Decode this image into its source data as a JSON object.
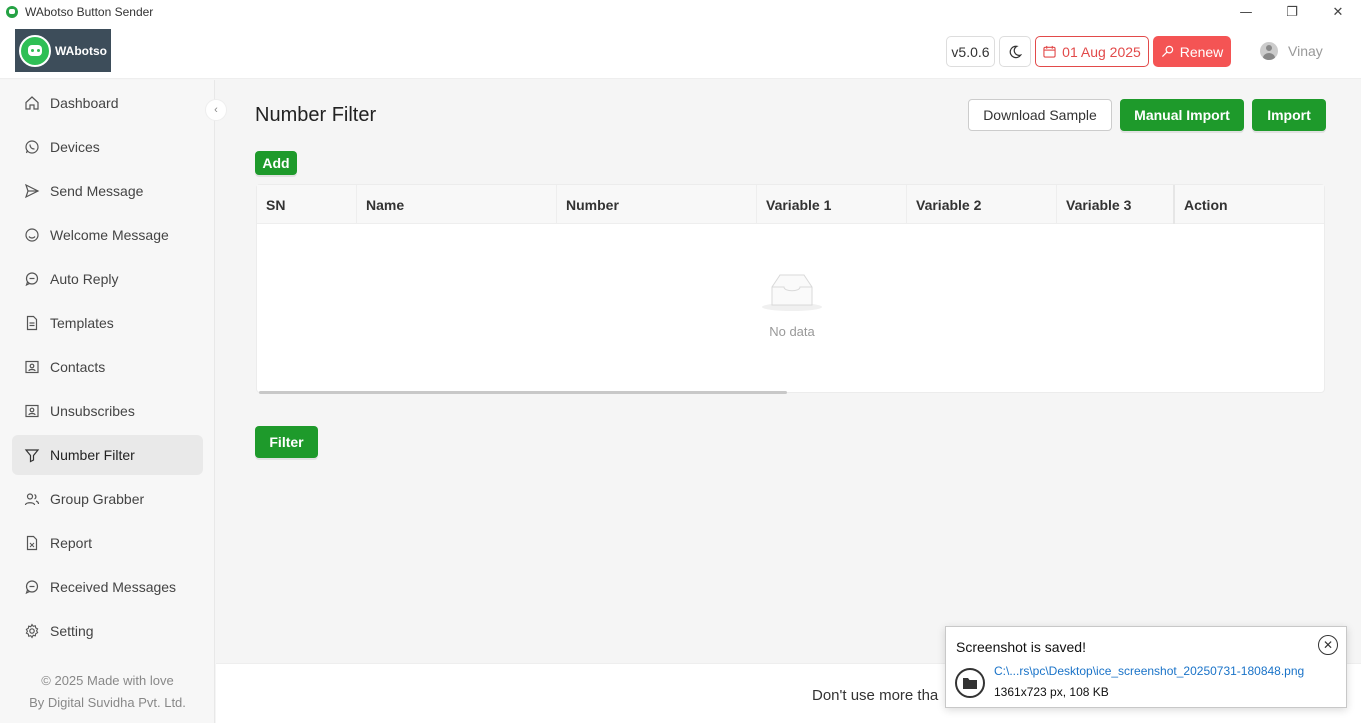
{
  "window": {
    "title": "WAbotso Button Sender",
    "controls": [
      "—",
      "❐",
      "✕"
    ]
  },
  "header": {
    "logo_text": "WAbotso",
    "version": "v5.0.6",
    "date": "01 Aug 2025",
    "renew_label": "Renew",
    "user_name": "Vinay",
    "accent_red": "#e24a4a"
  },
  "sidebar": {
    "items": [
      {
        "label": "Dashboard",
        "icon": "home-icon"
      },
      {
        "label": "Devices",
        "icon": "whatsapp-icon"
      },
      {
        "label": "Send Message",
        "icon": "send-icon"
      },
      {
        "label": "Welcome Message",
        "icon": "smile-icon"
      },
      {
        "label": "Auto Reply",
        "icon": "chat-icon"
      },
      {
        "label": "Templates",
        "icon": "document-icon"
      },
      {
        "label": "Contacts",
        "icon": "contacts-icon"
      },
      {
        "label": "Unsubscribes",
        "icon": "contacts-icon"
      },
      {
        "label": "Number Filter",
        "icon": "filter-icon"
      },
      {
        "label": "Group Grabber",
        "icon": "group-icon"
      },
      {
        "label": "Report",
        "icon": "report-icon"
      },
      {
        "label": "Received Messages",
        "icon": "chat-icon"
      },
      {
        "label": "Setting",
        "icon": "gear-icon"
      }
    ],
    "active": "Number Filter",
    "footer_line1": "© 2025 Made with love",
    "footer_line2": "By Digital Suvidha Pvt. Ltd."
  },
  "main": {
    "title": "Number Filter",
    "download_sample_label": "Download Sample",
    "manual_import_label": "Manual Import",
    "import_label": "Import",
    "add_label": "Add",
    "filter_label": "Filter",
    "table": {
      "columns": [
        "SN",
        "Name",
        "Number",
        "Variable 1",
        "Variable 2",
        "Variable 3",
        "Action"
      ],
      "rows": [],
      "empty_text": "No data"
    },
    "footer_text": "Don't use more tha",
    "accent_green": "#1e9a2b"
  },
  "toast": {
    "title": "Screenshot is saved!",
    "path": "C:\\...rs\\pc\\Desktop\\ice_screenshot_20250731-180848.png",
    "meta": "1361x723 px, 108 KB"
  }
}
